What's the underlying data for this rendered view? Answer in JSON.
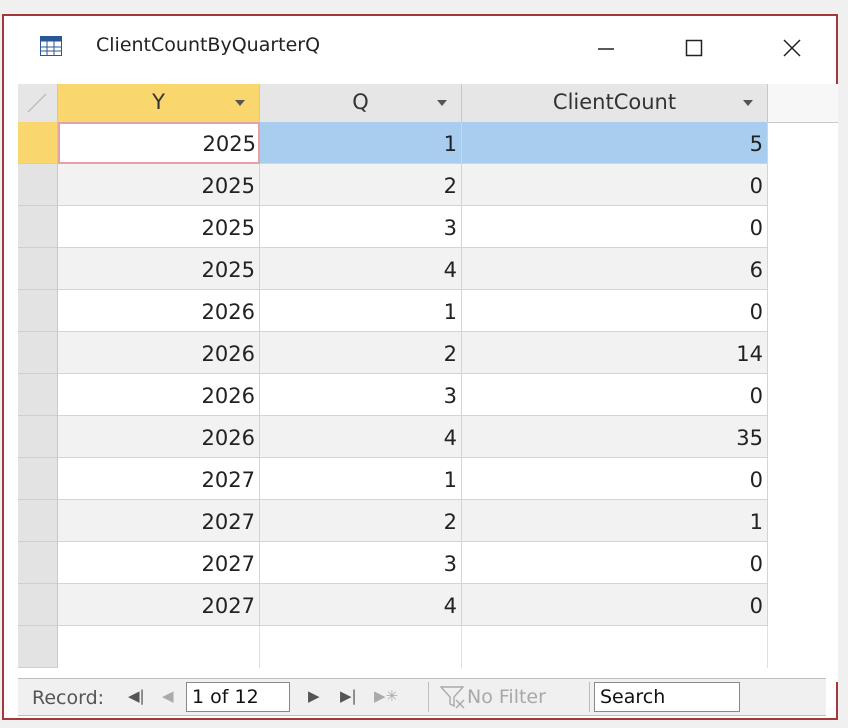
{
  "window": {
    "title": "ClientCountByQuarterQ",
    "accent": "#a4373a",
    "icons": [
      "datasheet-query-icon",
      "minimize-icon",
      "maximize-icon",
      "close-icon"
    ]
  },
  "columns": [
    {
      "label": "Y"
    },
    {
      "label": "Q"
    },
    {
      "label": "ClientCount"
    }
  ],
  "rows": [
    {
      "y": "2025",
      "q": "1",
      "count": "5"
    },
    {
      "y": "2025",
      "q": "2",
      "count": "0"
    },
    {
      "y": "2025",
      "q": "3",
      "count": "0"
    },
    {
      "y": "2025",
      "q": "4",
      "count": "6"
    },
    {
      "y": "2026",
      "q": "1",
      "count": "0"
    },
    {
      "y": "2026",
      "q": "2",
      "count": "14"
    },
    {
      "y": "2026",
      "q": "3",
      "count": "0"
    },
    {
      "y": "2026",
      "q": "4",
      "count": "35"
    },
    {
      "y": "2027",
      "q": "1",
      "count": "0"
    },
    {
      "y": "2027",
      "q": "2",
      "count": "1"
    },
    {
      "y": "2027",
      "q": "3",
      "count": "0"
    },
    {
      "y": "2027",
      "q": "4",
      "count": "0"
    }
  ],
  "navigation": {
    "label": "Record:",
    "position": "1 of 12",
    "filter_label": "No Filter",
    "search_label": "Search"
  },
  "colors": {
    "selected_header": "#f9d66e",
    "selected_cells": "#a8cdef",
    "active_cell_border": "#e7a0a6"
  }
}
